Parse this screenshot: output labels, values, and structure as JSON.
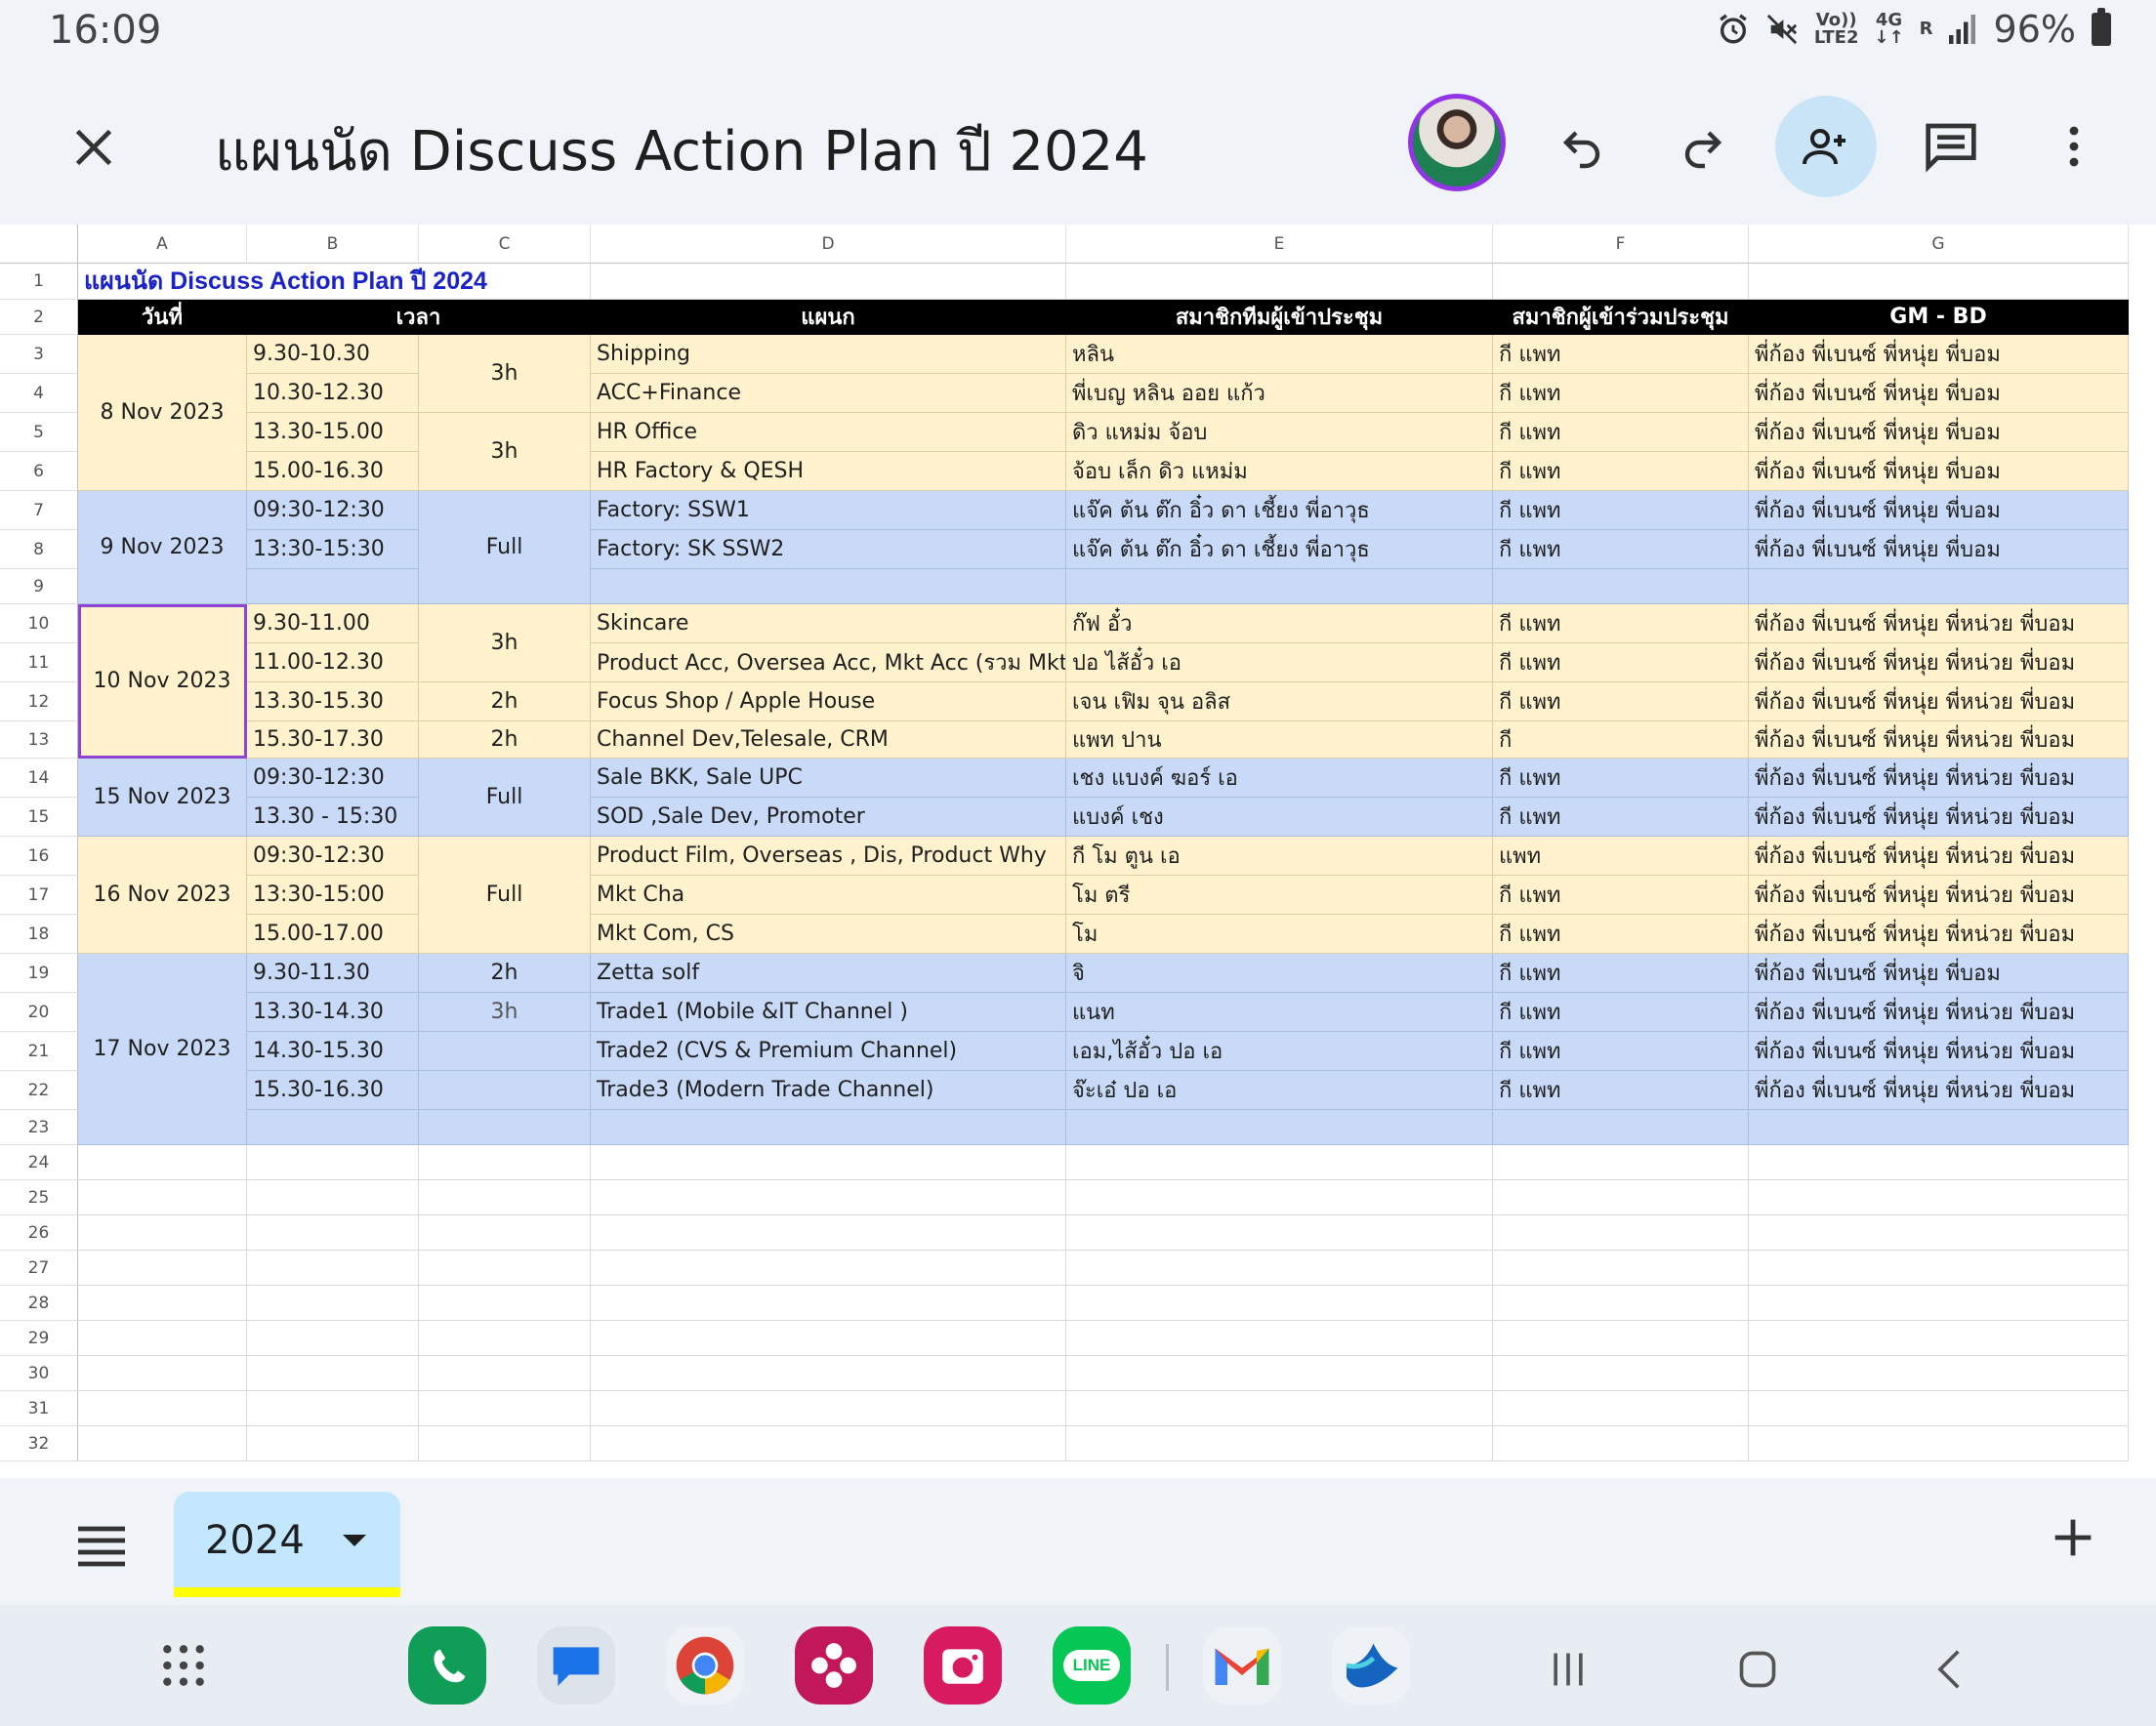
{
  "status": {
    "time": "16:09",
    "battery": "96%",
    "net_top": "Vo))",
    "net_bottom": "LTE2",
    "g4": "4G",
    "r": "R"
  },
  "toolbar": {
    "title": "แผนนัด Discuss Action Plan ปี 2024"
  },
  "columns": [
    "A",
    "B",
    "C",
    "D",
    "E",
    "F",
    "G"
  ],
  "sheet": {
    "row1_title": "แผนนัด Discuss Action Plan ปี 2024",
    "headers": [
      "วันที่",
      "เวลา",
      "แผนก",
      "สมาชิกทีมผู้เข้าประชุม",
      "สมาชิกผู้เข้าร่วมประชุม",
      "GM - BD"
    ],
    "dates": [
      "8 Nov 2023",
      "9 Nov 2023",
      "10 Nov 2023",
      "15 Nov 2023",
      "16 Nov 2023",
      "17 Nov 2023"
    ],
    "durations": {
      "r3": "3h",
      "r5": "3h",
      "r7": "Full",
      "r10": "3h",
      "r12": "2h",
      "r13": "2h",
      "r14": "Full",
      "r16": "Full",
      "r19": "2h",
      "r20": "3h"
    },
    "rows": [
      {
        "time": "9.30-10.30",
        "dept": "Shipping",
        "team": "หลิน",
        "join": "กี แพท",
        "gm": "พี่ก้อง พี่เบนซ์ พี่หนุ่ย  พี่บอม"
      },
      {
        "time": "10.30-12.30",
        "dept": "ACC+Finance",
        "team": "พี่เบญ หลิน ออย แก้ว",
        "join": "กี แพท",
        "gm": "พี่ก้อง พี่เบนซ์ พี่หนุ่ย  พี่บอม"
      },
      {
        "time": "13.30-15.00",
        "dept": "HR Office",
        "team": "ดิว แหม่ม จ้อบ",
        "join": "กี แพท",
        "gm": "พี่ก้อง พี่เบนซ์ พี่หนุ่ย  พี่บอม"
      },
      {
        "time": "15.00-16.30",
        "dept": "HR Factory & QESH",
        "team": "จ้อบ เล็ก ดิว  แหม่ม",
        "join": "กี แพท",
        "gm": "พี่ก้อง พี่เบนซ์ พี่หนุ่ย  พี่บอม"
      },
      {
        "time": "09:30-12:30",
        "dept": "Factory:  SSW1",
        "team": "แจ๊ค ต้น ต๊ก อิ๋ว  ดา เชี้ยง พี่อาวุธ",
        "join": "กี แพท",
        "gm": "พี่ก้อง พี่เบนซ์ พี่หนุ่ย พี่บอม"
      },
      {
        "time": "13:30-15:30",
        "dept": "Factory:   SK SSW2",
        "team": "แจ๊ค ต้น ต๊ก อิ๋ว  ดา เชี้ยง พี่อาวุธ",
        "join": "กี แพท",
        "gm": "พี่ก้อง พี่เบนซ์ พี่หนุ่ย พี่บอม"
      },
      {
        "time": "",
        "dept": "",
        "team": "",
        "join": "",
        "gm": ""
      },
      {
        "time": "9.30-11.00",
        "dept": "Skincare",
        "team": "ก๊ฟ อั๋ว",
        "join": "กี แพท",
        "gm": "พี่ก้อง พี่เบนซ์  พี่หนุ่ย   พี่หน่วย พี่บอม"
      },
      {
        "time": "11.00-12.30",
        "dept": "Product Acc, Oversea Acc, Mkt Acc  (รวม Mkt)",
        "team": "ปอ  ไส้อั๋ว   เอ",
        "join": "กี แพท",
        "gm": "พี่ก้อง พี่เบนซ์  พี่หนุ่ย  พี่หน่วย พี่บอม"
      },
      {
        "time": "13.30-15.30",
        "dept": "Focus Shop / Apple House",
        "team": "เจน เฟิม จุน อลิส",
        "join": "กี แพท",
        "gm": "พี่ก้อง พี่เบนซ์  พี่หนุ่ย  พี่หน่วย พี่บอม"
      },
      {
        "time": "15.30-17.30",
        "dept": "Channel Dev,Telesale, CRM",
        "team": "แพท ปาน",
        "join": "กี",
        "gm": "พี่ก้อง พี่เบนซ์  พี่หนุ่ย  พี่หน่วย พี่บอม"
      },
      {
        "time": "09:30-12:30",
        "dept": "Sale BKK, Sale UPC",
        "team": "เชง แบงค์  ฆอร์  เอ",
        "join": "กี แพท",
        "gm": "พี่ก้อง พี่เบนซ์  พี่หนุ่ย  พี่หน่วย พี่บอม"
      },
      {
        "time": "13.30 - 15:30",
        "dept": "SOD ,Sale Dev, Promoter",
        "team": "แบงค์  เชง",
        "join": "กี แพท",
        "gm": "พี่ก้อง พี่เบนซ์  พี่หนุ่ย  พี่หน่วย พี่บอม"
      },
      {
        "time": "09:30-12:30",
        "dept": "Product Film, Overseas , Dis, Product Why",
        "team": "กี โม ตูน เอ",
        "join": "แพท",
        "gm": "พี่ก้อง พี่เบนซ์  พี่หนุ่ย  พี่หน่วย พี่บอม"
      },
      {
        "time": "13:30-15:00",
        "dept": "Mkt Cha",
        "team": "โม ตรี",
        "join": "กี แพท",
        "gm": "พี่ก้อง พี่เบนซ์  พี่หนุ่ย  พี่หน่วย พี่บอม"
      },
      {
        "time": "15.00-17.00",
        "dept": "Mkt Com, CS",
        "team": "โม",
        "join": "กี แพท",
        "gm": "พี่ก้อง พี่เบนซ์  พี่หนุ่ย  พี่หน่วย พี่บอม"
      },
      {
        "time": "9.30-11.30",
        "dept": "Zetta solf",
        "team": " จิ",
        "join": "กี แพท",
        "gm": "พี่ก้อง พี่เบนซ์  พี่หนุ่ย   พี่บอม"
      },
      {
        "time": "13.30-14.30",
        "dept": "Trade1 (Mobile &IT Channel )",
        "team": "แนท",
        "join": "กี แพท",
        "gm": "พี่ก้อง พี่เบนซ์  พี่หนุ่ย  พี่หน่วย พี่บอม"
      },
      {
        "time": "14.30-15.30",
        "dept": "Trade2 (CVS & Premium Channel)",
        "team": "เอม,ไส้อั๋ว  ปอ เอ",
        "join": "กี แพท",
        "gm": "พี่ก้อง พี่เบนซ์  พี่หนุ่ย  พี่หน่วย พี่บอม"
      },
      {
        "time": "15.30-16.30",
        "dept": "Trade3 (Modern Trade Channel)",
        "team": "จ๊ะเอ๋ ปอ เอ",
        "join": "กี แพท",
        "gm": "พี่ก้อง พี่เบนซ์  พี่หนุ่ย  พี่หน่วย พี่บอม"
      },
      {
        "time": "",
        "dept": "",
        "team": "",
        "join": "",
        "gm": ""
      }
    ],
    "row_numbers": [
      "1",
      "2",
      "3",
      "4",
      "5",
      "6",
      "7",
      "8",
      "9",
      "10",
      "11",
      "12",
      "13",
      "14",
      "15",
      "16",
      "17",
      "18",
      "19",
      "20",
      "21",
      "22",
      "23",
      "24",
      "25",
      "26",
      "27",
      "28",
      "29",
      "30",
      "31",
      "32"
    ]
  },
  "tabs": {
    "active": "2024"
  },
  "dock": {
    "line_label": "LINE"
  },
  "colors": {
    "accent": "#8e44d0",
    "yellow": "#fff2cc",
    "blue": "#c9daf8",
    "title_blue": "#1a23c8"
  }
}
